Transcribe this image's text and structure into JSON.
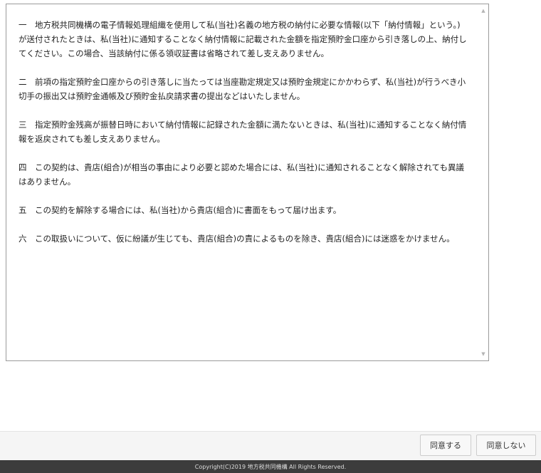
{
  "terms": {
    "paragraphs": [
      "一　地方税共同機構の電子情報処理組織を使用して私(当社)名義の地方税の納付に必要な情報(以下「納付情報」という。)が送付されたときは、私(当社)に通知することなく納付情報に記載された金額を指定預貯金口座から引き落しの上、納付してください。この場合、当該納付に係る領収証書は省略されて差し支えありません。",
      "二　前項の指定預貯金口座からの引き落しに当たっては当座勘定規定又は預貯金規定にかかわらず、私(当社)が行うべき小切手の振出又は預貯金通帳及び預貯金払戻請求書の提出などはいたしません。",
      "三　指定預貯金残高が振替日時において納付情報に記録された金額に満たないときは、私(当社)に通知することなく納付情報を返戻されても差し支えありません。",
      "四　この契約は、貴店(組合)が相当の事由により必要と認めた場合には、私(当社)に通知されることなく解除されても異議はありません。",
      "五　この契約を解除する場合には、私(当社)から貴店(組合)に書面をもって届け出ます。",
      "六　この取扱いについて、仮に紛議が生じても、貴店(組合)の責によるものを除き、貴店(組合)には迷惑をかけません。"
    ]
  },
  "actions": {
    "agree_label": "同意する",
    "disagree_label": "同意しない"
  },
  "footer": {
    "copyright": "Copyright(C)2019 地方税共同機構 All Rights Reserved."
  },
  "icons": {
    "scroll_up": "scroll-up-arrow-icon",
    "scroll_down": "scroll-down-arrow-icon"
  }
}
